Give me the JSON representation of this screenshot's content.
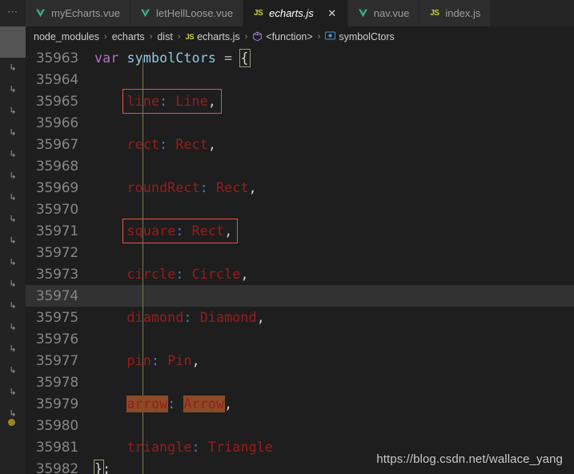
{
  "window": {
    "title": "echarts.js — Visual Studio Code"
  },
  "tabbar": {
    "overflow_label": "⋯",
    "tabs": [
      {
        "label": "myEcharts.vue",
        "icon": "vue-icon",
        "active": false,
        "closable": false
      },
      {
        "label": "letHellLoose.vue",
        "icon": "vue-icon",
        "active": false,
        "closable": false
      },
      {
        "label": "echarts.js",
        "icon": "javascript-icon",
        "active": true,
        "closable": true,
        "close_label": "✕"
      },
      {
        "label": "nav.vue",
        "icon": "vue-icon",
        "active": false,
        "closable": false
      },
      {
        "label": "index.js",
        "icon": "javascript-icon",
        "active": false,
        "closable": false
      }
    ]
  },
  "breadcrumb": {
    "separator": "›",
    "items": [
      {
        "label": "node_modules",
        "icon": ""
      },
      {
        "label": "echarts",
        "icon": ""
      },
      {
        "label": "dist",
        "icon": ""
      },
      {
        "label": "echarts.js",
        "icon": "javascript-icon"
      },
      {
        "label": "<function>",
        "icon": "symbol-function-icon"
      },
      {
        "label": "symbolCtors",
        "icon": "symbol-object-icon"
      }
    ]
  },
  "gutter": {
    "fold_marker": "↳",
    "fold_marker_count": 17,
    "breakpoint_color": "#9a8521"
  },
  "editor": {
    "current_line": 35974,
    "lines": [
      {
        "num": "35963",
        "text": "var symbolCtors = {"
      },
      {
        "num": "35964",
        "text": ""
      },
      {
        "num": "35965",
        "text": "    line: Line,"
      },
      {
        "num": "35966",
        "text": ""
      },
      {
        "num": "35967",
        "text": "    rect: Rect,"
      },
      {
        "num": "35968",
        "text": ""
      },
      {
        "num": "35969",
        "text": "    roundRect: Rect,"
      },
      {
        "num": "35970",
        "text": ""
      },
      {
        "num": "35971",
        "text": "    square: Rect,"
      },
      {
        "num": "35972",
        "text": ""
      },
      {
        "num": "35973",
        "text": "    circle: Circle,"
      },
      {
        "num": "35974",
        "text": ""
      },
      {
        "num": "35975",
        "text": "    diamond: Diamond,"
      },
      {
        "num": "35976",
        "text": ""
      },
      {
        "num": "35977",
        "text": "    pin: Pin,"
      },
      {
        "num": "35978",
        "text": ""
      },
      {
        "num": "35979",
        "text": "    arrow: Arrow,"
      },
      {
        "num": "35980",
        "text": ""
      },
      {
        "num": "35981",
        "text": "    triangle: Triangle"
      },
      {
        "num": "35982",
        "text": "};"
      }
    ],
    "tokens": {
      "l35963": {
        "kw": "var",
        "space1": " ",
        "ident": "symbolCtors",
        "space2": " ",
        "op": "=",
        "space3": " ",
        "brace": "{"
      },
      "l35965": {
        "indent": "    ",
        "prop": "line",
        "colon": ":",
        "space": " ",
        "value": "Line",
        "comma": ","
      },
      "l35967": {
        "indent": "    ",
        "prop": "rect",
        "colon": ":",
        "space": " ",
        "value": "Rect",
        "comma": ","
      },
      "l35969": {
        "indent": "    ",
        "prop": "roundRect",
        "colon": ":",
        "space": " ",
        "value": "Rect",
        "comma": ","
      },
      "l35971": {
        "indent": "    ",
        "prop": "square",
        "colon": ":",
        "space": " ",
        "value": "Rect",
        "comma": ","
      },
      "l35973": {
        "indent": "    ",
        "prop": "circle",
        "colon": ":",
        "space": " ",
        "value": "Circle",
        "comma": ","
      },
      "l35975": {
        "indent": "    ",
        "prop": "diamond",
        "colon": ":",
        "space": " ",
        "value": "Diamond",
        "comma": ","
      },
      "l35977": {
        "indent": "    ",
        "prop": "pin",
        "colon": ":",
        "space": " ",
        "value": "Pin",
        "comma": ","
      },
      "l35979": {
        "indent": "    ",
        "prop": "arrow",
        "colon": ":",
        "space": " ",
        "value": "Arrow",
        "comma": ","
      },
      "l35981": {
        "indent": "    ",
        "prop": "triangle",
        "colon": ":",
        "space": " ",
        "value": "Triangle",
        "comma": ""
      },
      "l35982": {
        "brace": "}",
        "semi": ";"
      }
    },
    "annotations": {
      "red_boxes": [
        {
          "target": "line: Line,",
          "color": "#f14c4c"
        },
        {
          "target": "square: Rect,",
          "color": "#f14c4c"
        }
      ],
      "search_highlights": [
        {
          "target": "arrow",
          "color": "#8a4b26"
        },
        {
          "target": "Arrow",
          "color": "#8a4b26"
        }
      ],
      "bracket_matches": [
        {
          "target": "{",
          "line": "35963"
        },
        {
          "target": "}",
          "line": "35982"
        }
      ]
    }
  },
  "watermark": {
    "text": "https://blog.csdn.net/wallace_yang"
  },
  "colors": {
    "editor_bg": "#1e1e1e",
    "tabbar_bg": "#252526",
    "tab_inactive_bg": "#2d2d2d",
    "line_number": "#868686",
    "code_red": "#9b1c1c",
    "keyword_purple": "#b072c8",
    "identifier_blue": "#8fc8e8",
    "colon_blue": "#3f7fd0",
    "current_line_bg": "#323232",
    "find_match_bg": "#8a4b26",
    "red_box_border": "#f14c4c",
    "indent_guide": "#7a7a52",
    "js_icon": "#cbcb41",
    "vue_icon": "#8dc149"
  }
}
